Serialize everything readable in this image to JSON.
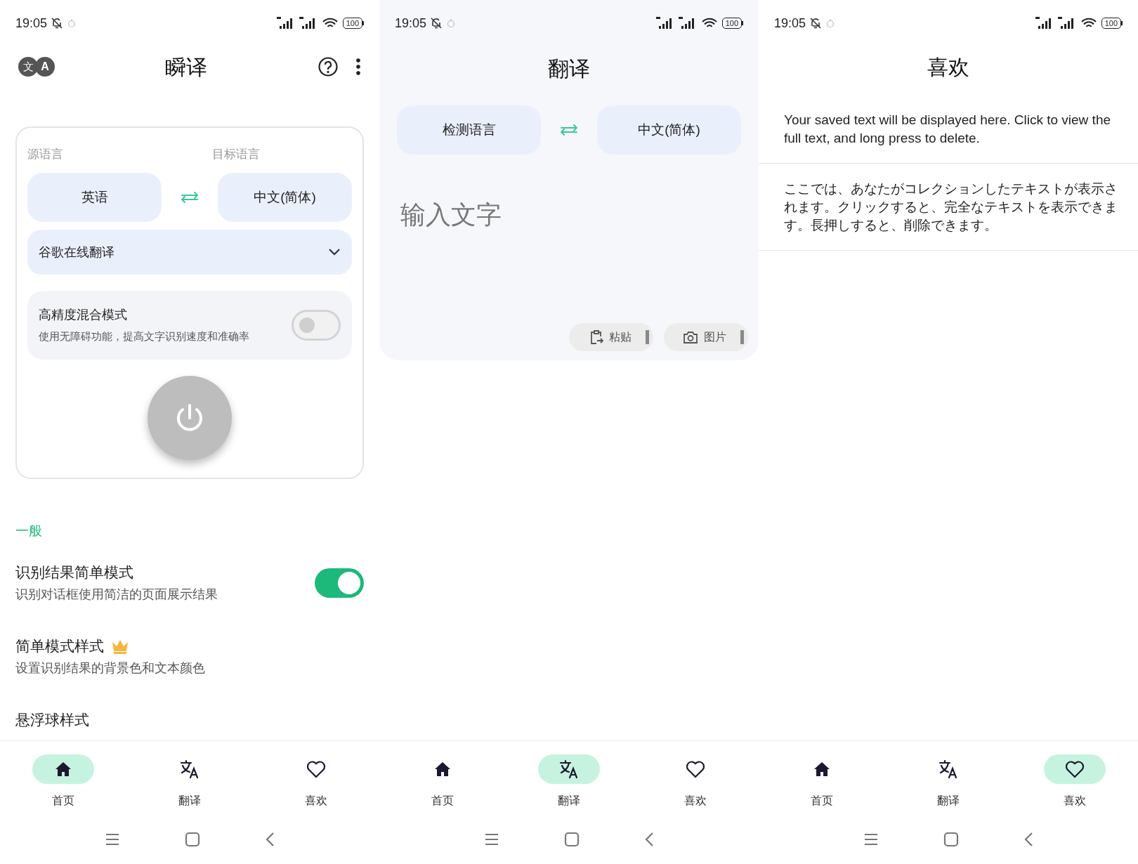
{
  "screens": [
    {
      "kind": "home",
      "status_bar": {
        "time": "19:05",
        "battery": "100"
      },
      "title": "瞬译",
      "logo": [
        "文",
        "A"
      ],
      "card": {
        "source_label": "源语言",
        "target_label": "目标语言",
        "source": "英语",
        "target": "中文(简体)",
        "engine": "谷歌在线翻译",
        "mode": {
          "title": "高精度混合模式",
          "description": "使用无障碍功能，提高文字识别速度和准确率",
          "on": false
        }
      },
      "section": "一般",
      "settings": [
        {
          "kind": "toggle",
          "title": "识别结果简单模式",
          "description": "识别对话框使用简洁的页面展示结果",
          "on": true
        },
        {
          "kind": "premium",
          "title": "简单模式样式",
          "description": "设置识别结果的背景色和文本颜色"
        },
        {
          "kind": "plain",
          "title": "悬浮球样式"
        }
      ],
      "nav": [
        {
          "label": "首页",
          "selected": true
        },
        {
          "label": "翻译",
          "selected": false
        },
        {
          "label": "喜欢",
          "selected": false
        }
      ]
    },
    {
      "kind": "translate",
      "status_bar": {
        "time": "19:05",
        "battery": "100"
      },
      "title": "翻译",
      "source": "检测语言",
      "target": "中文(简体)",
      "input": {
        "placeholder": "输入文字"
      },
      "actions": [
        {
          "kind": "paste",
          "label": "粘贴"
        },
        {
          "kind": "image",
          "label": "图片"
        }
      ],
      "nav": [
        {
          "label": "首页",
          "selected": false
        },
        {
          "label": "翻译",
          "selected": true
        },
        {
          "label": "喜欢",
          "selected": false
        }
      ]
    },
    {
      "kind": "favorites",
      "status_bar": {
        "time": "19:05",
        "battery": "100"
      },
      "title": "喜欢",
      "items": [
        "Your saved text will be displayed here. Click to view the full text, and long press to delete.",
        "ここでは、あなたがコレクションしたテキストが表示されます。クリックすると、完全なテキストを表示できます。長押しすると、削除できます。"
      ],
      "nav": [
        {
          "label": "首页",
          "selected": false
        },
        {
          "label": "翻译",
          "selected": false
        },
        {
          "label": "喜欢",
          "selected": true
        }
      ]
    }
  ]
}
